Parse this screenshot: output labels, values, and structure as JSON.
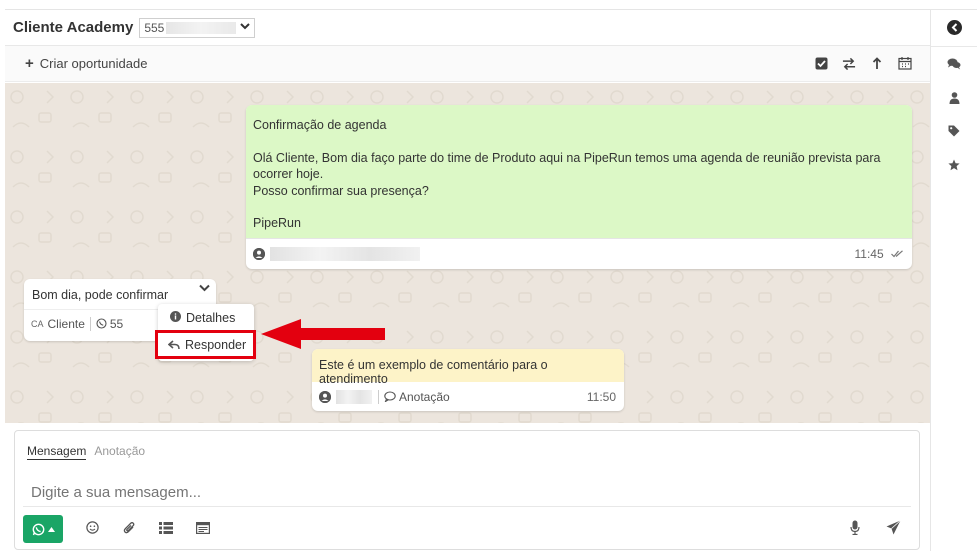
{
  "header": {
    "title": "Cliente Academy",
    "phone_prefix": "555"
  },
  "toolbar": {
    "create_opportunity": "Criar oportunidade"
  },
  "messages": {
    "sent": {
      "line1": "Confirmação de agenda",
      "line2": "Olá Cliente, Bom dia faço parte do time de Produto aqui na PipeRun temos uma agenda de reunião prevista para ocorrer hoje.",
      "line3": "Posso confirmar sua presença?",
      "line4": "PipeRun",
      "time": "11:45"
    },
    "received": {
      "text": "Bom dia, pode confirmar",
      "badge": "CA",
      "sender": "Cliente",
      "phone_prefix": "55"
    },
    "note": {
      "text": "Este é um exemplo de comentário para o atendimento",
      "type": "Anotação",
      "time": "11:50"
    }
  },
  "context_menu": {
    "details": "Detalhes",
    "reply": "Responder"
  },
  "composer": {
    "tab_message": "Mensagem",
    "tab_note": "Anotação",
    "placeholder": "Digite a sua mensagem..."
  },
  "colors": {
    "sent_bg": "#dcf8c6",
    "note_bg": "#fdf3c8",
    "highlight": "#e3000f",
    "whatsapp": "#1aa566"
  }
}
